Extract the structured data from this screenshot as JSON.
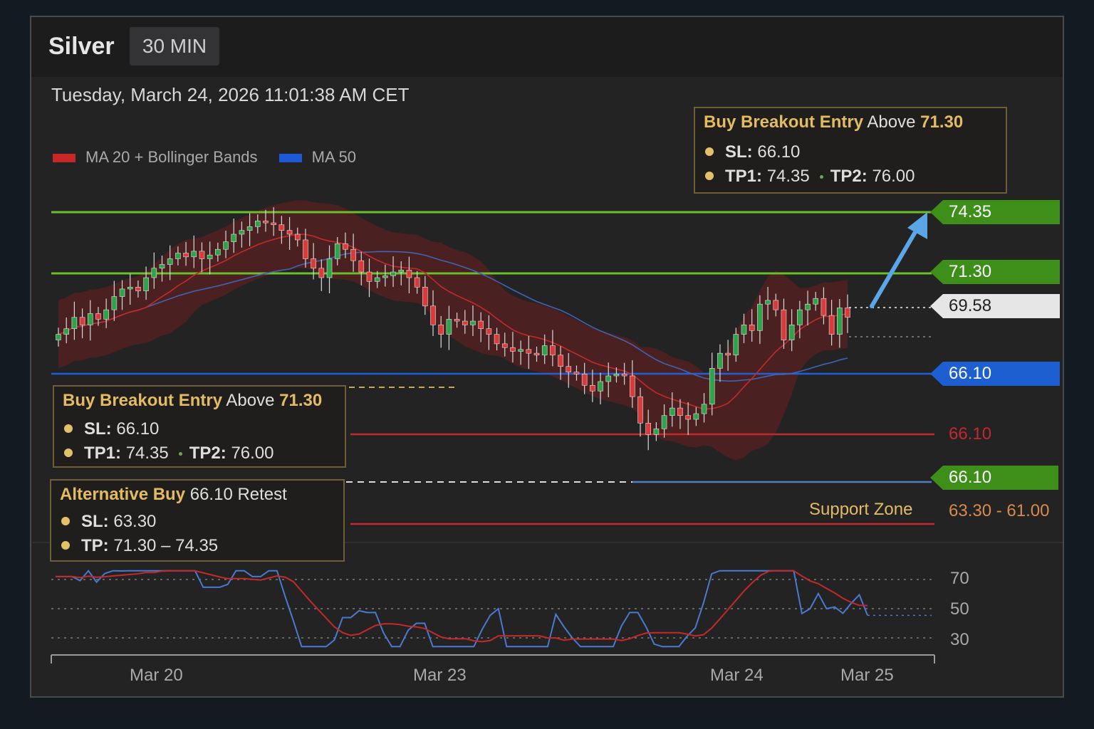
{
  "header": {
    "instrument": "Silver",
    "timeframe": "30 MIN"
  },
  "timestamp": "Tuesday, March 24, 2026 11:01:38 AM CET",
  "legend": [
    {
      "label": "MA 20 + Bollinger Bands",
      "color": "#c62828"
    },
    {
      "label": "MA 50",
      "color": "#1e5ad6"
    }
  ],
  "colors": {
    "bull": "#2fa34a",
    "bear": "#d93a3a",
    "resistance": "#6cbf2a",
    "support_blue": "#1f5fd8",
    "stop_red": "#c22a2a",
    "band_fill": "#7a1c1c",
    "accent_gold": "#e3bb62",
    "arrow": "#5aa6e6"
  },
  "top_box": {
    "title": "Buy Breakout Entry",
    "cond": "Above",
    "level": "71.30",
    "sl_label": "SL:",
    "sl": "66.10",
    "tp1_label": "TP1:",
    "tp1": "74.35",
    "tp2_label": "TP2:",
    "tp2": "76.00"
  },
  "mid_box": {
    "title": "Buy Breakout Entry",
    "cond": "Above",
    "level": "71.30",
    "sl_label": "SL:",
    "sl": "66.10",
    "tp1_label": "TP1:",
    "tp1": "74.35",
    "tp2_label": "TP2:",
    "tp2": "76.00"
  },
  "alt_box": {
    "title": "Alternative Buy",
    "cond": "66.10 Retest",
    "sl_label": "SL:",
    "sl": "63.30",
    "tp_label": "TP:",
    "tp": "71.30 – 74.35"
  },
  "price_tags": {
    "target": "74.35",
    "entry": "71.30",
    "last": "69.58",
    "sl_blue": "66.10",
    "sl_red": "66.10",
    "sl_green": "66.10"
  },
  "support_zone": {
    "label": "Support Zone",
    "range": "63.30 - 61.00"
  },
  "x_labels": [
    "Mar 20",
    "Mar 23",
    "Mar 24",
    "Mar 25"
  ],
  "rsi_ticks": [
    "70",
    "50",
    "30"
  ],
  "chart_data": {
    "type": "candlestick",
    "ylim": [
      56.2,
      76.4
    ],
    "candle_count": 100,
    "levels": [
      {
        "name": "TP1",
        "value": 74.35
      },
      {
        "name": "Breakout entry",
        "value": 71.3
      },
      {
        "name": "Last price",
        "value": 69.58
      },
      {
        "name": "SL",
        "value": 66.1
      }
    ],
    "candles_close": [
      68.5,
      68.8,
      69.4,
      69.0,
      69.6,
      69.3,
      69.8,
      70.5,
      70.9,
      71.0,
      70.8,
      71.5,
      72.0,
      72.2,
      72.5,
      72.8,
      72.6,
      72.9,
      72.5,
      72.7,
      73.0,
      73.4,
      73.8,
      74.0,
      74.2,
      74.5,
      74.4,
      74.3,
      74.0,
      73.8,
      73.5,
      72.5,
      72.0,
      71.5,
      72.5,
      73.3,
      73.0,
      72.4,
      71.8,
      71.3,
      71.5,
      71.6,
      71.8,
      71.9,
      71.5,
      71.0,
      70.0,
      69.0,
      68.5,
      69.3,
      69.2,
      69.0,
      69.2,
      68.8,
      68.5,
      68.0,
      67.8,
      67.6,
      67.7,
      67.5,
      67.4,
      67.9,
      67.4,
      66.8,
      66.5,
      66.4,
      65.8,
      65.5,
      66.0,
      66.3,
      66.4,
      66.3,
      65.2,
      63.8,
      63.2,
      63.5,
      64.2,
      64.6,
      64.2,
      64.0,
      64.3,
      64.8,
      66.7,
      67.5,
      67.4,
      68.5,
      69.0,
      68.7,
      70.1,
      70.3,
      69.8,
      68.2,
      69.0,
      69.8,
      70.1,
      70.4,
      69.5,
      68.5,
      69.9,
      69.4
    ]
  }
}
